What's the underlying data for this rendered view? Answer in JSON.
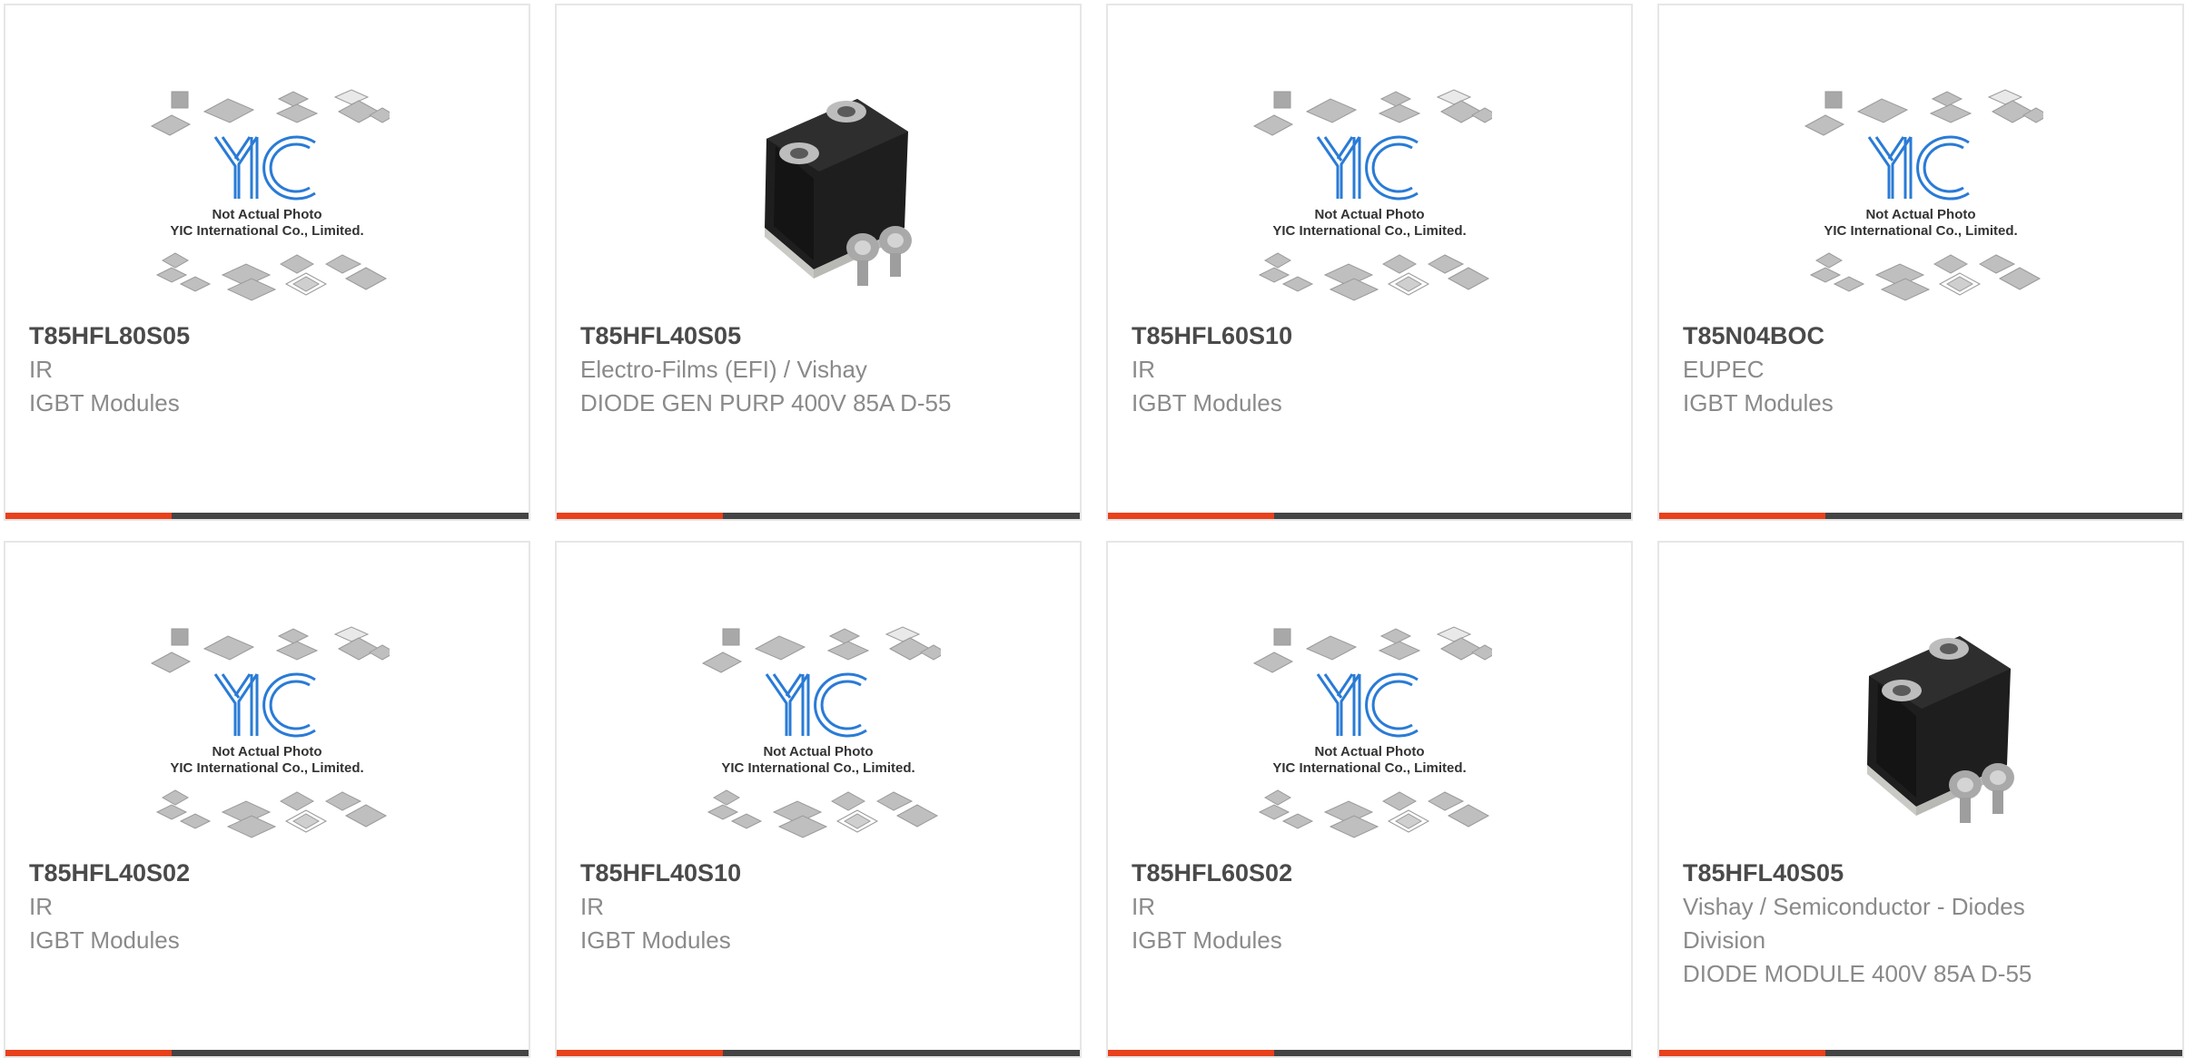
{
  "colors": {
    "accent": "#e8411c",
    "bar": "#444444",
    "title": "#4a4a4a",
    "text": "#8a8a8a",
    "logo": "#2a7bd6"
  },
  "placeholder_image": {
    "line1": "Not Actual Photo",
    "line2": "YIC International Co., Limited.",
    "logo_text": "YIC"
  },
  "products": [
    {
      "part": "T85HFL80S05",
      "manufacturer": "IR",
      "description": "IGBT Modules",
      "image": "placeholder"
    },
    {
      "part": "T85HFL40S05",
      "manufacturer": "Electro-Films (EFI) / Vishay",
      "description": "DIODE GEN PURP 400V 85A D-55",
      "image": "module"
    },
    {
      "part": "T85HFL60S10",
      "manufacturer": "IR",
      "description": "IGBT Modules",
      "image": "placeholder"
    },
    {
      "part": "T85N04BOC",
      "manufacturer": "EUPEC",
      "description": "IGBT Modules",
      "image": "placeholder"
    },
    {
      "part": "T85HFL40S02",
      "manufacturer": "IR",
      "description": "IGBT Modules",
      "image": "placeholder"
    },
    {
      "part": "T85HFL40S10",
      "manufacturer": "IR",
      "description": "IGBT Modules",
      "image": "placeholder"
    },
    {
      "part": "T85HFL60S02",
      "manufacturer": "IR",
      "description": "IGBT Modules",
      "image": "placeholder"
    },
    {
      "part": "T85HFL40S05",
      "manufacturer": "Vishay / Semiconductor - Diodes Division",
      "description": "DIODE MODULE 400V 85A D-55",
      "image": "module"
    }
  ]
}
